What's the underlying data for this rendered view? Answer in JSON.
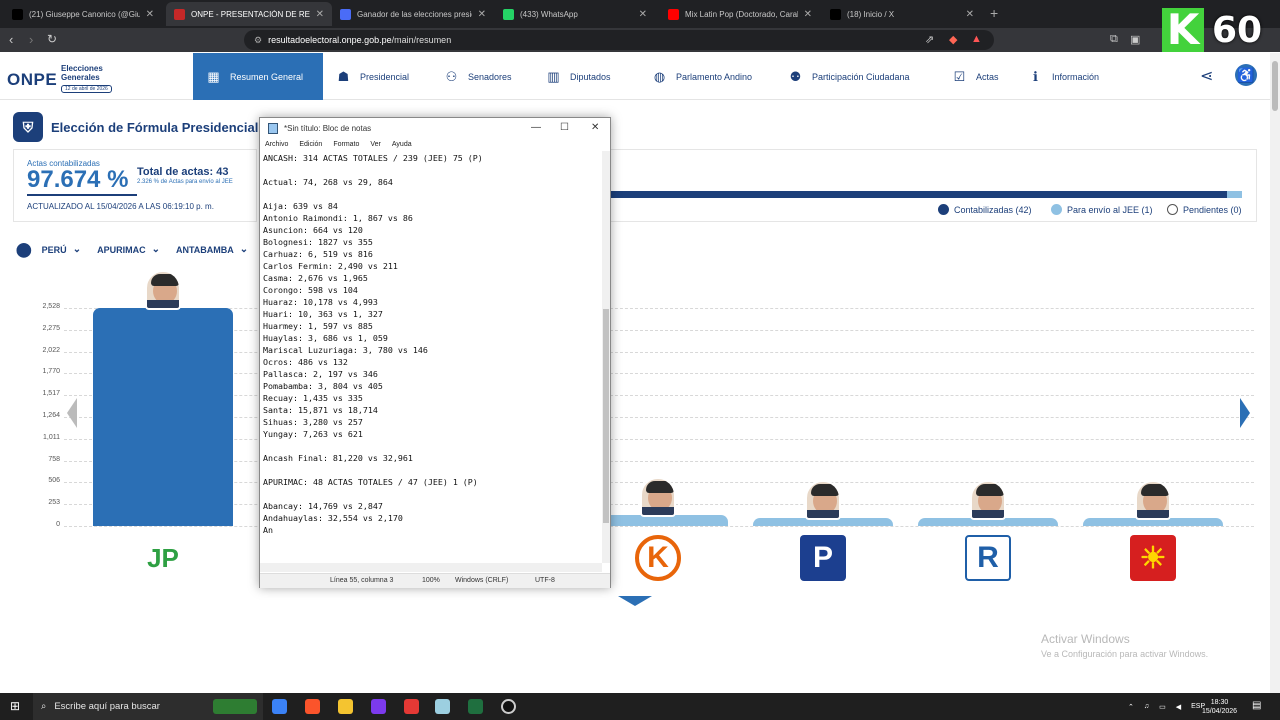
{
  "browser": {
    "tabs": [
      {
        "title": "(21) Giuseppe Canonico (@Giuseppi",
        "icon": "x-icon",
        "color": "#000000"
      },
      {
        "title": "ONPE - PRESENTACIÓN DE RESULT",
        "icon": "onpe-icon",
        "color": "#c62828"
      },
      {
        "title": "Ganador de las elecciones presidenc",
        "icon": "search-icon",
        "color": "#4a6cf7"
      },
      {
        "title": "(433) WhatsApp",
        "icon": "whatsapp-icon",
        "color": "#25d366"
      },
      {
        "title": "Mix Latin Pop (Doctorado, Caralu",
        "icon": "youtube-icon",
        "color": "#ff0000"
      },
      {
        "title": "(18) Inicio / X",
        "icon": "x-icon",
        "color": "#000000"
      }
    ],
    "url_host": "resultadoelectoral.onpe.gob.pe",
    "url_path": "/main/resumen",
    "overlay_k": "K",
    "overlay_num": "60"
  },
  "site": {
    "logo": "ONPE",
    "logo_title_1": "Elecciones",
    "logo_title_2": "Generales",
    "logo_date": "12 de abril de 2026",
    "nav": [
      {
        "label": "Resumen General",
        "icon": "grid-icon",
        "active": true
      },
      {
        "label": "Presidencial",
        "icon": "ballot-icon"
      },
      {
        "label": "Senadores",
        "icon": "people-icon"
      },
      {
        "label": "Diputados",
        "icon": "building-icon"
      },
      {
        "label": "Parlamento Andino",
        "icon": "globe-icon"
      },
      {
        "label": "Participación Ciudadana",
        "icon": "participation-icon"
      },
      {
        "label": "Actas",
        "icon": "check-doc-icon"
      },
      {
        "label": "Información",
        "icon": "info-icon"
      }
    ]
  },
  "main": {
    "page_title": "Elección de Fórmula Presidencial",
    "actas_label": "Actas contabilizadas",
    "actas_pct": "97.674 %",
    "total_actas": "Total de actas: 43",
    "jee_text": "2.326 % de Actas para envío al JEE",
    "updated": "ACTUALIZADO AL 15/04/2026 A LAS 06:19:10 p. m.",
    "progress_fraction": 0.977,
    "legend": [
      {
        "label": "Contabilizadas (42)",
        "color": "#1c3f7a"
      },
      {
        "label": "Para envío al JEE (1)",
        "color": "#8fc1e3"
      },
      {
        "label": "Pendientes (0)",
        "color": "#ffffff"
      }
    ],
    "filters": [
      "PERÚ",
      "APURIMAC",
      "ANTABAMBA"
    ]
  },
  "chart_data": {
    "type": "bar",
    "ylim": [
      0,
      2528
    ],
    "yticks": [
      "2,528",
      "2,275",
      "2,022",
      "1,770",
      "1,517",
      "1,264",
      "1,011",
      "758",
      "506",
      "253",
      "0"
    ],
    "series": [
      {
        "party": "Juntos por el Perú",
        "value": 2528,
        "color": "#2b6fb5"
      },
      {
        "party": "Fuerza Popular",
        "value": 125,
        "color": "#8fc1e3"
      },
      {
        "party": "Podemos Perú",
        "value": 50,
        "color": "#8fc1e3"
      },
      {
        "party": "Renovación Popular",
        "value": 50,
        "color": "#8fc1e3"
      },
      {
        "party": "País para Todos",
        "value": 50,
        "color": "#8fc1e3"
      }
    ]
  },
  "notepad": {
    "title": "*Sin título: Bloc de notas",
    "menu": [
      "Archivo",
      "Edición",
      "Formato",
      "Ver",
      "Ayuda"
    ],
    "text": "ANCASH: 314 ACTAS TOTALES / 239 (JEE) 75 (P)\n\nActual: 74, 268 vs 29, 864\n\nAija: 639 vs 84\nAntonio Raimondi: 1, 867 vs 86\nAsuncion: 664 vs 120\nBolognesi: 1827 vs 355\nCarhuaz: 6, 519 vs 816\nCarlos Fermin: 2,490 vs 211\nCasma: 2,676 vs 1,965\nCorongo: 598 vs 104\nHuaraz: 10,178 vs 4,993\nHuari: 10, 363 vs 1, 327\nHuarmey: 1, 597 vs 885\nHuaylas: 3, 686 vs 1, 059\nMariscal Luzuriaga: 3, 780 vs 146\nOcros: 486 vs 132\nPallasca: 2, 197 vs 346\nPomabamba: 3, 804 vs 405\nRecuay: 1,435 vs 335\nSanta: 15,871 vs 18,714\nSihuas: 3,280 vs 257\nYungay: 7,263 vs 621\n\nAncash Final: 81,220 vs 32,961\n\nAPURIMAC: 48 ACTAS TOTALES / 47 (JEE) 1 (P)\n\nAbancay: 14,769 vs 2,847\nAndahuaylas: 32,554 vs 2,170\nAn",
    "status_pos": "Línea 55, columna 3",
    "status_zoom": "100%",
    "status_eol": "Windows (CRLF)",
    "status_enc": "UTF-8"
  },
  "watermark": {
    "line1": "Activar Windows",
    "line2": "Ve a Configuración para activar Windows."
  },
  "taskbar": {
    "search": "Escribe aquí para buscar",
    "lang": "ESP",
    "time": "18:30",
    "date": "15/04/2026"
  }
}
